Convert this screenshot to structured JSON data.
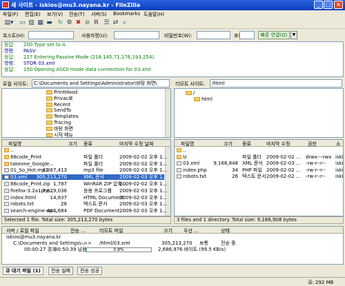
{
  "window": {
    "title": "새 사이트 - iskios@mu3.nayana.kr - FileZilla"
  },
  "menu": [
    "파일(F)",
    "편집(E)",
    "보기(V)",
    "전송(T)",
    "서버(S)",
    "Bookmarks",
    "도움말(H)"
  ],
  "quickconnect": {
    "host_label": "호스트(H):",
    "user_label": "사용자명(U):",
    "pass_label": "비밀번호(W):",
    "port_label": "포트(P):",
    "connect_label": "빠른 연결(Q)"
  },
  "log": [
    {
      "label": "응답:",
      "text": "200 Type set to A",
      "color": "#008000"
    },
    {
      "label": "명령:",
      "text": "PASV",
      "color": "#000080"
    },
    {
      "label": "응답:",
      "text": "227 Entering Passive Mode (218,145,71,176,193,254).",
      "color": "#008000"
    },
    {
      "label": "명령:",
      "text": "STOR 03.xml",
      "color": "#000080"
    },
    {
      "label": "응답:",
      "text": "150 Opening ASCII mode data connection for 03.xml",
      "color": "#008000"
    }
  ],
  "local": {
    "site_label": "로컬 사이트:",
    "path": "C:\\Documents and Settings\\Administrator\\바탕 화면\\",
    "tree": [
      "PrintHood",
      "PrivacIE",
      "Recent",
      "SendTo",
      "Templates",
      "Tracing",
      "바탕 화면",
      "시작 메뉴"
    ],
    "headers": [
      "파일명",
      "크기",
      "종류",
      "마지막 수정 날짜"
    ],
    "files": [
      {
        "name": "..",
        "size": "",
        "type": "",
        "date": ""
      },
      {
        "name": "88code_Print",
        "size": "",
        "type": "파일 폴더",
        "date": "2009-02-02 오후 1..."
      },
      {
        "name": "takeone_Google...",
        "size": "",
        "type": "파일 폴더",
        "date": "2009-02-02 오후 1..."
      },
      {
        "name": "01_So_Hot.mp3",
        "size": "4,367,413",
        "type": "mp3 file",
        "date": "2009-02-03 오후 1..."
      },
      {
        "name": "03.xml",
        "size": "305,213,270",
        "type": "XML 문서",
        "date": "2009-02-03 오후 1..."
      },
      {
        "name": "88code_Print.zip",
        "size": "1,787",
        "type": "WinRAR ZIP 압축...",
        "date": "2009-02-02 오후 1..."
      },
      {
        "name": "firefox-3.2a1pre...",
        "size": "7,829,036",
        "type": "응용 프로그램",
        "date": "2009-02-03 오후 1..."
      },
      {
        "name": "index.html",
        "size": "14,837",
        "type": "HTML Document",
        "date": "2009-02-03 오후 1..."
      },
      {
        "name": "robots.txt",
        "size": "28",
        "type": "텍스트 문서",
        "date": "2009-02-03 오후 1..."
      },
      {
        "name": "search-engine-op...",
        "size": "446,684",
        "type": "PDF Document",
        "date": "2009-02-03 오후 1..."
      }
    ],
    "status": "Selected 1 file. Total size: 305,213,270 bytes"
  },
  "remote": {
    "site_label": "리모트 사이트:",
    "path": "/html",
    "tree": [
      "/",
      "html"
    ],
    "headers": [
      "파일명",
      "크기",
      "종류",
      "마지막 수정",
      "권한",
      "소"
    ],
    "files": [
      {
        "name": "..",
        "size": "",
        "type": "",
        "date": "",
        "perm": "",
        "owner": ""
      },
      {
        "name": "lz",
        "size": "",
        "type": "파일 폴더",
        "date": "2009-02-02 ...",
        "perm": "drwx---rwx",
        "owner": "iski"
      },
      {
        "name": "03.xml",
        "size": "9,166,848",
        "type": "XML 문서",
        "date": "2009-02-03 ...",
        "perm": "-rw-r--r--",
        "owner": "iski"
      },
      {
        "name": "index.php",
        "size": "34",
        "type": "PHP 파일",
        "date": "2009-02-02 ...",
        "perm": "-rw-r--r--",
        "owner": "iski"
      },
      {
        "name": "robots.txt",
        "size": "26",
        "type": "텍스트 문서",
        "date": "2009-02-02 ...",
        "perm": "-rw-r--r--",
        "owner": "iski"
      }
    ],
    "status": "3 files and 1 directory. Total size: 9,166,908 bytes"
  },
  "queue": {
    "headers": [
      "서버 / 로컬 파일",
      "전송 ...",
      "리모트 파일",
      "크기",
      "우선 ...",
      "상태"
    ],
    "server": "iskios@mu3.nayana.kr",
    "local_file": "C:\\Documents and Settings\\...",
    "direction": "-->>",
    "remote_file": "/html/03.xml",
    "size": "305,213,270",
    "priority": "보통",
    "status": "전송 중",
    "elapsed": "00:00:27 경과",
    "remaining": "00:50:39 남음",
    "progress_text": "0.8%",
    "progress_fraction": 0.008,
    "rate": "2,686,976 바이트 (99.5 KB/s)"
  },
  "tabs": [
    "큐 대기 파일 (1)",
    "전송 실패",
    "전송 성공"
  ],
  "statusbar": {
    "queue": "큐: 292 MB"
  }
}
